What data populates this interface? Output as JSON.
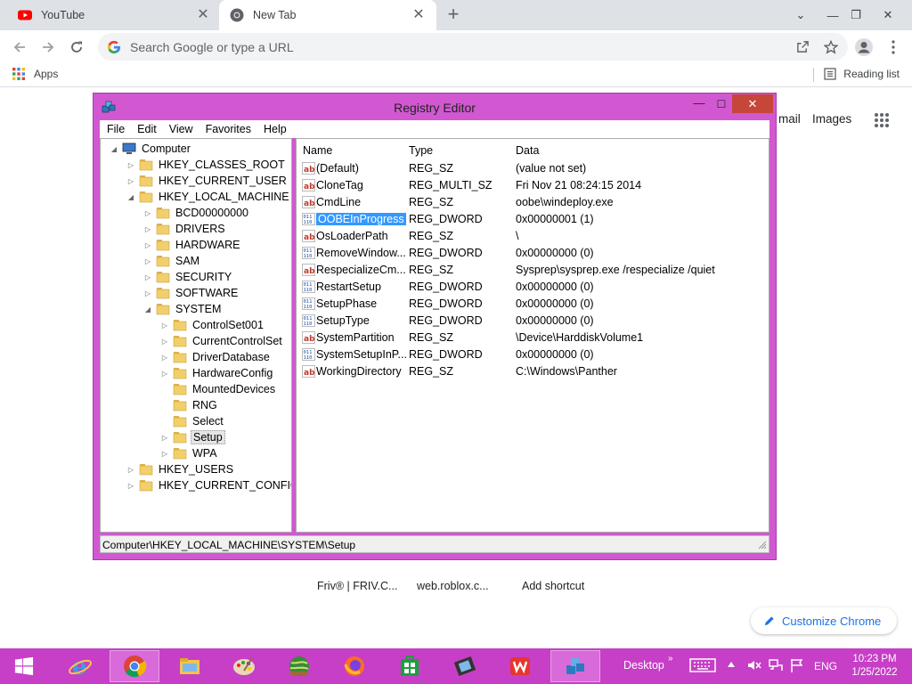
{
  "browser": {
    "tabs": [
      {
        "title": "YouTube",
        "close": "✕"
      },
      {
        "title": "New Tab",
        "close": "✕"
      }
    ],
    "new_tab_glyph": "+",
    "window_controls": {
      "minimize": "⌄",
      "minimize2": "—",
      "restore": "❐",
      "close": "✕"
    },
    "omnibox": {
      "placeholder": "Search Google or type a URL"
    },
    "bookmarks": {
      "apps": "Apps",
      "reading_list": "Reading list"
    },
    "accent": "#1a73e8"
  },
  "ntp": {
    "gmail_partial": "mail",
    "images": "Images",
    "shortcuts": [
      "Friv® | FRIV.C...",
      "web.roblox.c...",
      "Add shortcut"
    ],
    "customize": "Customize Chrome"
  },
  "regedit": {
    "title": "Registry Editor",
    "controls": {
      "minimize": "—",
      "maximize": "☐",
      "close": "✕"
    },
    "menu": [
      "File",
      "Edit",
      "View",
      "Favorites",
      "Help"
    ],
    "tree": [
      {
        "label": "Computer",
        "depth": 0,
        "arrow": "◢",
        "icon": "computer-icon"
      },
      {
        "label": "HKEY_CLASSES_ROOT",
        "depth": 1,
        "arrow": "▷"
      },
      {
        "label": "HKEY_CURRENT_USER",
        "depth": 1,
        "arrow": "▷"
      },
      {
        "label": "HKEY_LOCAL_MACHINE",
        "depth": 1,
        "arrow": "◢"
      },
      {
        "label": "BCD00000000",
        "depth": 2,
        "arrow": "▷"
      },
      {
        "label": "DRIVERS",
        "depth": 2,
        "arrow": "▷"
      },
      {
        "label": "HARDWARE",
        "depth": 2,
        "arrow": "▷"
      },
      {
        "label": "SAM",
        "depth": 2,
        "arrow": "▷"
      },
      {
        "label": "SECURITY",
        "depth": 2,
        "arrow": "▷"
      },
      {
        "label": "SOFTWARE",
        "depth": 2,
        "arrow": "▷"
      },
      {
        "label": "SYSTEM",
        "depth": 2,
        "arrow": "◢"
      },
      {
        "label": "ControlSet001",
        "depth": 3,
        "arrow": "▷"
      },
      {
        "label": "CurrentControlSet",
        "depth": 3,
        "arrow": "▷"
      },
      {
        "label": "DriverDatabase",
        "depth": 3,
        "arrow": "▷"
      },
      {
        "label": "HardwareConfig",
        "depth": 3,
        "arrow": "▷"
      },
      {
        "label": "MountedDevices",
        "depth": 3,
        "arrow": ""
      },
      {
        "label": "RNG",
        "depth": 3,
        "arrow": ""
      },
      {
        "label": "Select",
        "depth": 3,
        "arrow": ""
      },
      {
        "label": "Setup",
        "depth": 3,
        "arrow": "▷",
        "selected": true
      },
      {
        "label": "WPA",
        "depth": 3,
        "arrow": "▷"
      },
      {
        "label": "HKEY_USERS",
        "depth": 1,
        "arrow": "▷"
      },
      {
        "label": "HKEY_CURRENT_CONFIG",
        "depth": 1,
        "arrow": "▷"
      }
    ],
    "columns": {
      "name": "Name",
      "type": "Type",
      "data": "Data"
    },
    "values": [
      {
        "name": "(Default)",
        "type": "REG_SZ",
        "data": "(value not set)",
        "icon": "ab"
      },
      {
        "name": "CloneTag",
        "type": "REG_MULTI_SZ",
        "data": "Fri Nov 21 08:24:15 2014",
        "icon": "ab"
      },
      {
        "name": "CmdLine",
        "type": "REG_SZ",
        "data": "oobe\\windeploy.exe",
        "icon": "ab"
      },
      {
        "name": "OOBEInProgress",
        "type": "REG_DWORD",
        "data": "0x00000001 (1)",
        "icon": "bin",
        "selected": true
      },
      {
        "name": "OsLoaderPath",
        "type": "REG_SZ",
        "data": "\\",
        "icon": "ab"
      },
      {
        "name": "RemoveWindow...",
        "type": "REG_DWORD",
        "data": "0x00000000 (0)",
        "icon": "bin"
      },
      {
        "name": "RespecializeCm...",
        "type": "REG_SZ",
        "data": "Sysprep\\sysprep.exe /respecialize /quiet",
        "icon": "ab"
      },
      {
        "name": "RestartSetup",
        "type": "REG_DWORD",
        "data": "0x00000000 (0)",
        "icon": "bin"
      },
      {
        "name": "SetupPhase",
        "type": "REG_DWORD",
        "data": "0x00000000 (0)",
        "icon": "bin"
      },
      {
        "name": "SetupType",
        "type": "REG_DWORD",
        "data": "0x00000000 (0)",
        "icon": "bin"
      },
      {
        "name": "SystemPartition",
        "type": "REG_SZ",
        "data": "\\Device\\HarddiskVolume1",
        "icon": "ab"
      },
      {
        "name": "SystemSetupInP...",
        "type": "REG_DWORD",
        "data": "0x00000000 (0)",
        "icon": "bin"
      },
      {
        "name": "WorkingDirectory",
        "type": "REG_SZ",
        "data": "C:\\Windows\\Panther",
        "icon": "ab"
      }
    ],
    "status_path": "Computer\\HKEY_LOCAL_MACHINE\\SYSTEM\\Setup",
    "frame_color": "#d158d1"
  },
  "taskbar": {
    "desktop_label": "Desktop",
    "chevron": "»",
    "language": "ENG",
    "time": "10:23 PM",
    "date": "1/25/2022",
    "color": "#c63fc6"
  }
}
